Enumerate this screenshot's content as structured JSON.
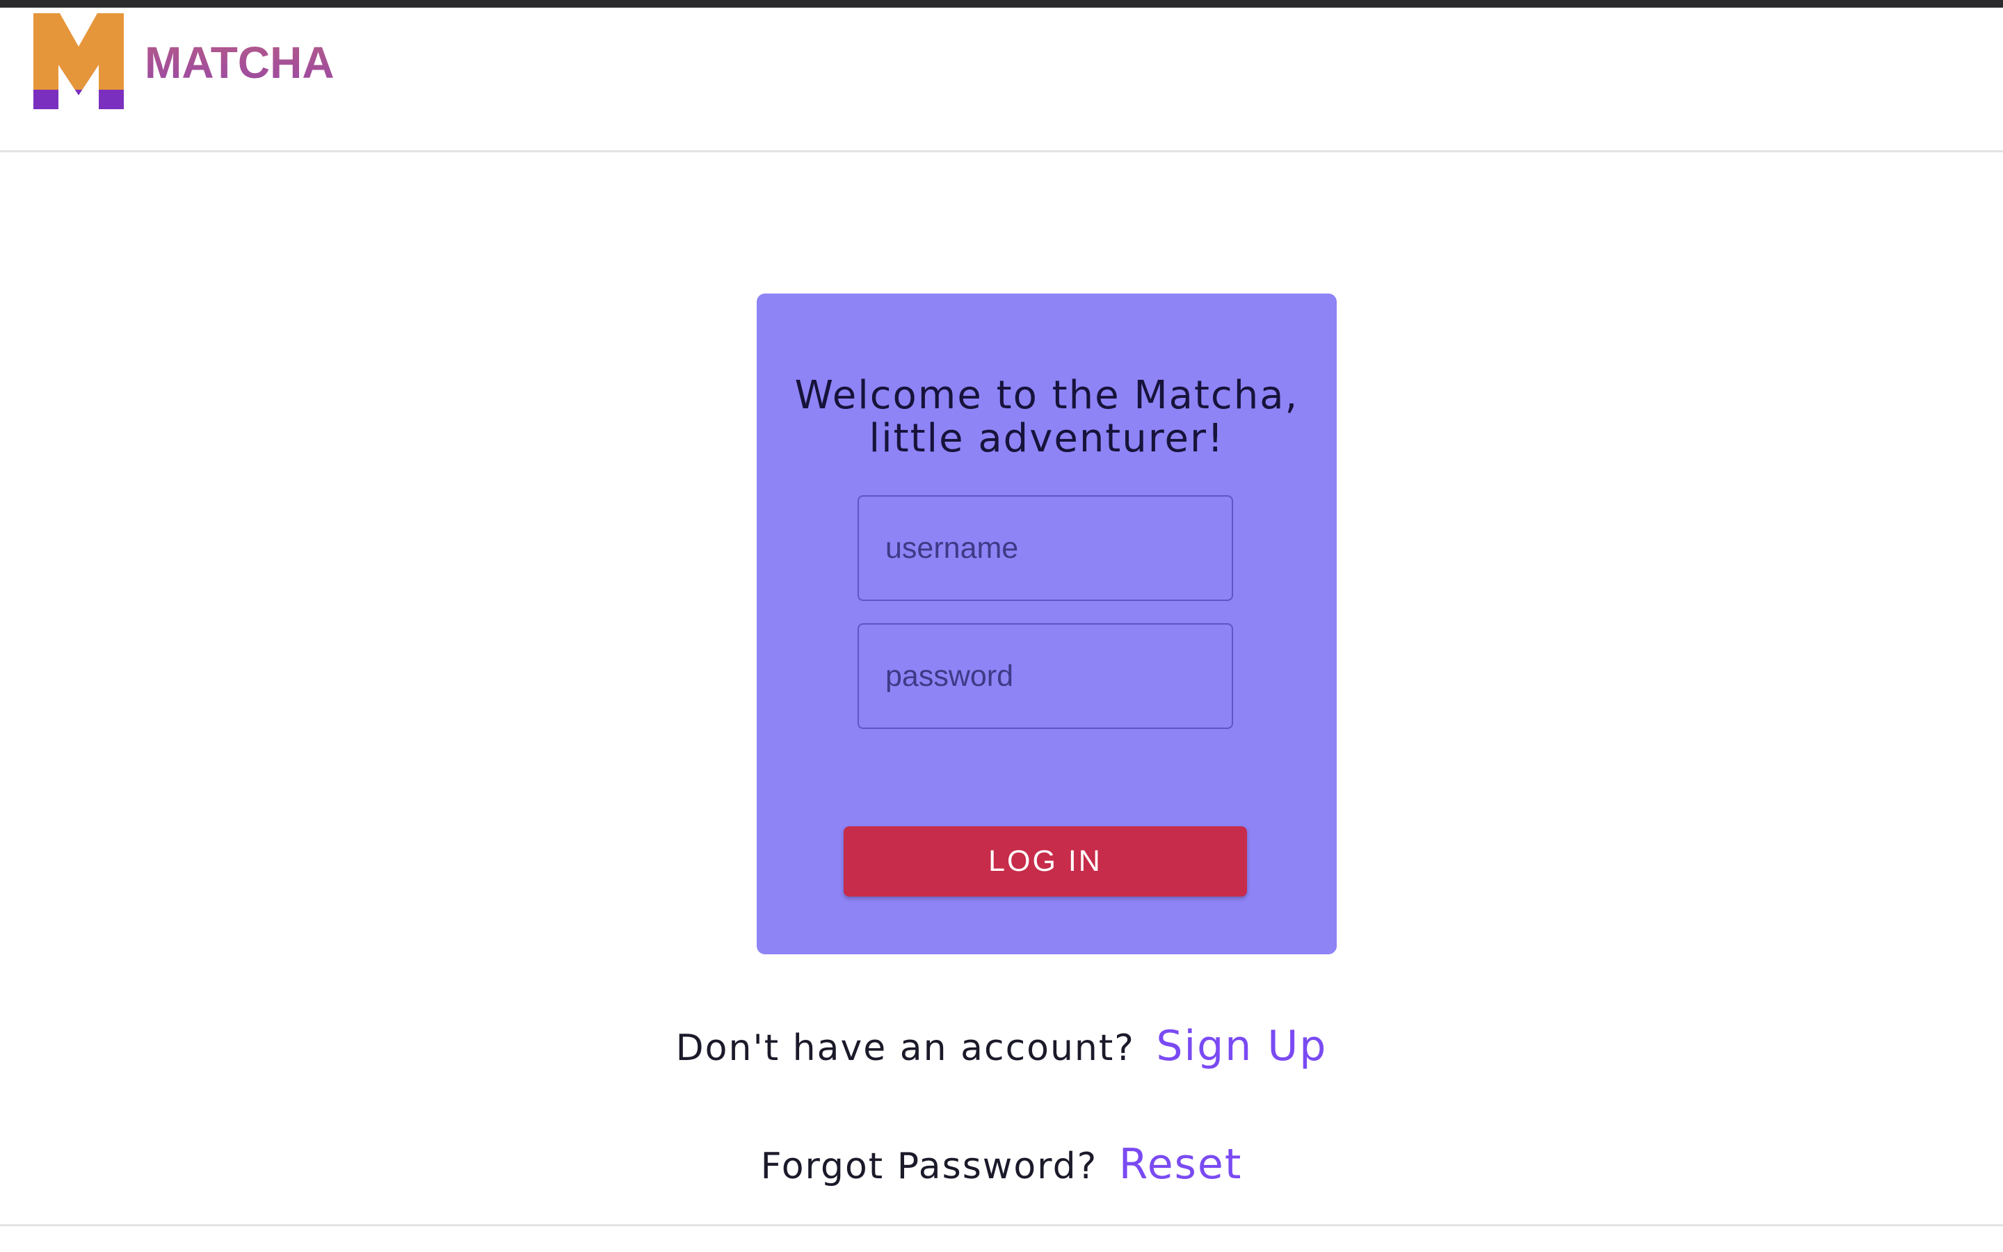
{
  "header": {
    "app_name": "MATCHA",
    "logo_icon": "matcha-m-logo-icon"
  },
  "login_card": {
    "title_line1": "Welcome to the Matcha,",
    "title_line2": "little adventurer!",
    "username_placeholder": "username",
    "password_placeholder": "password",
    "username_value": "",
    "password_value": "",
    "login_label": "LOG IN"
  },
  "signup_prompt": {
    "text": "Don't have an account?",
    "link_label": "Sign Up"
  },
  "reset_prompt": {
    "text": "Forgot Password?",
    "link_label": "Reset"
  },
  "colors": {
    "card_background": "#8e84f6",
    "login_button": "#c72c4a",
    "link": "#7a4af2",
    "logo_orange": "#e6963a",
    "logo_purple": "#7a2fbe",
    "brand_text": "#a34e8c"
  }
}
